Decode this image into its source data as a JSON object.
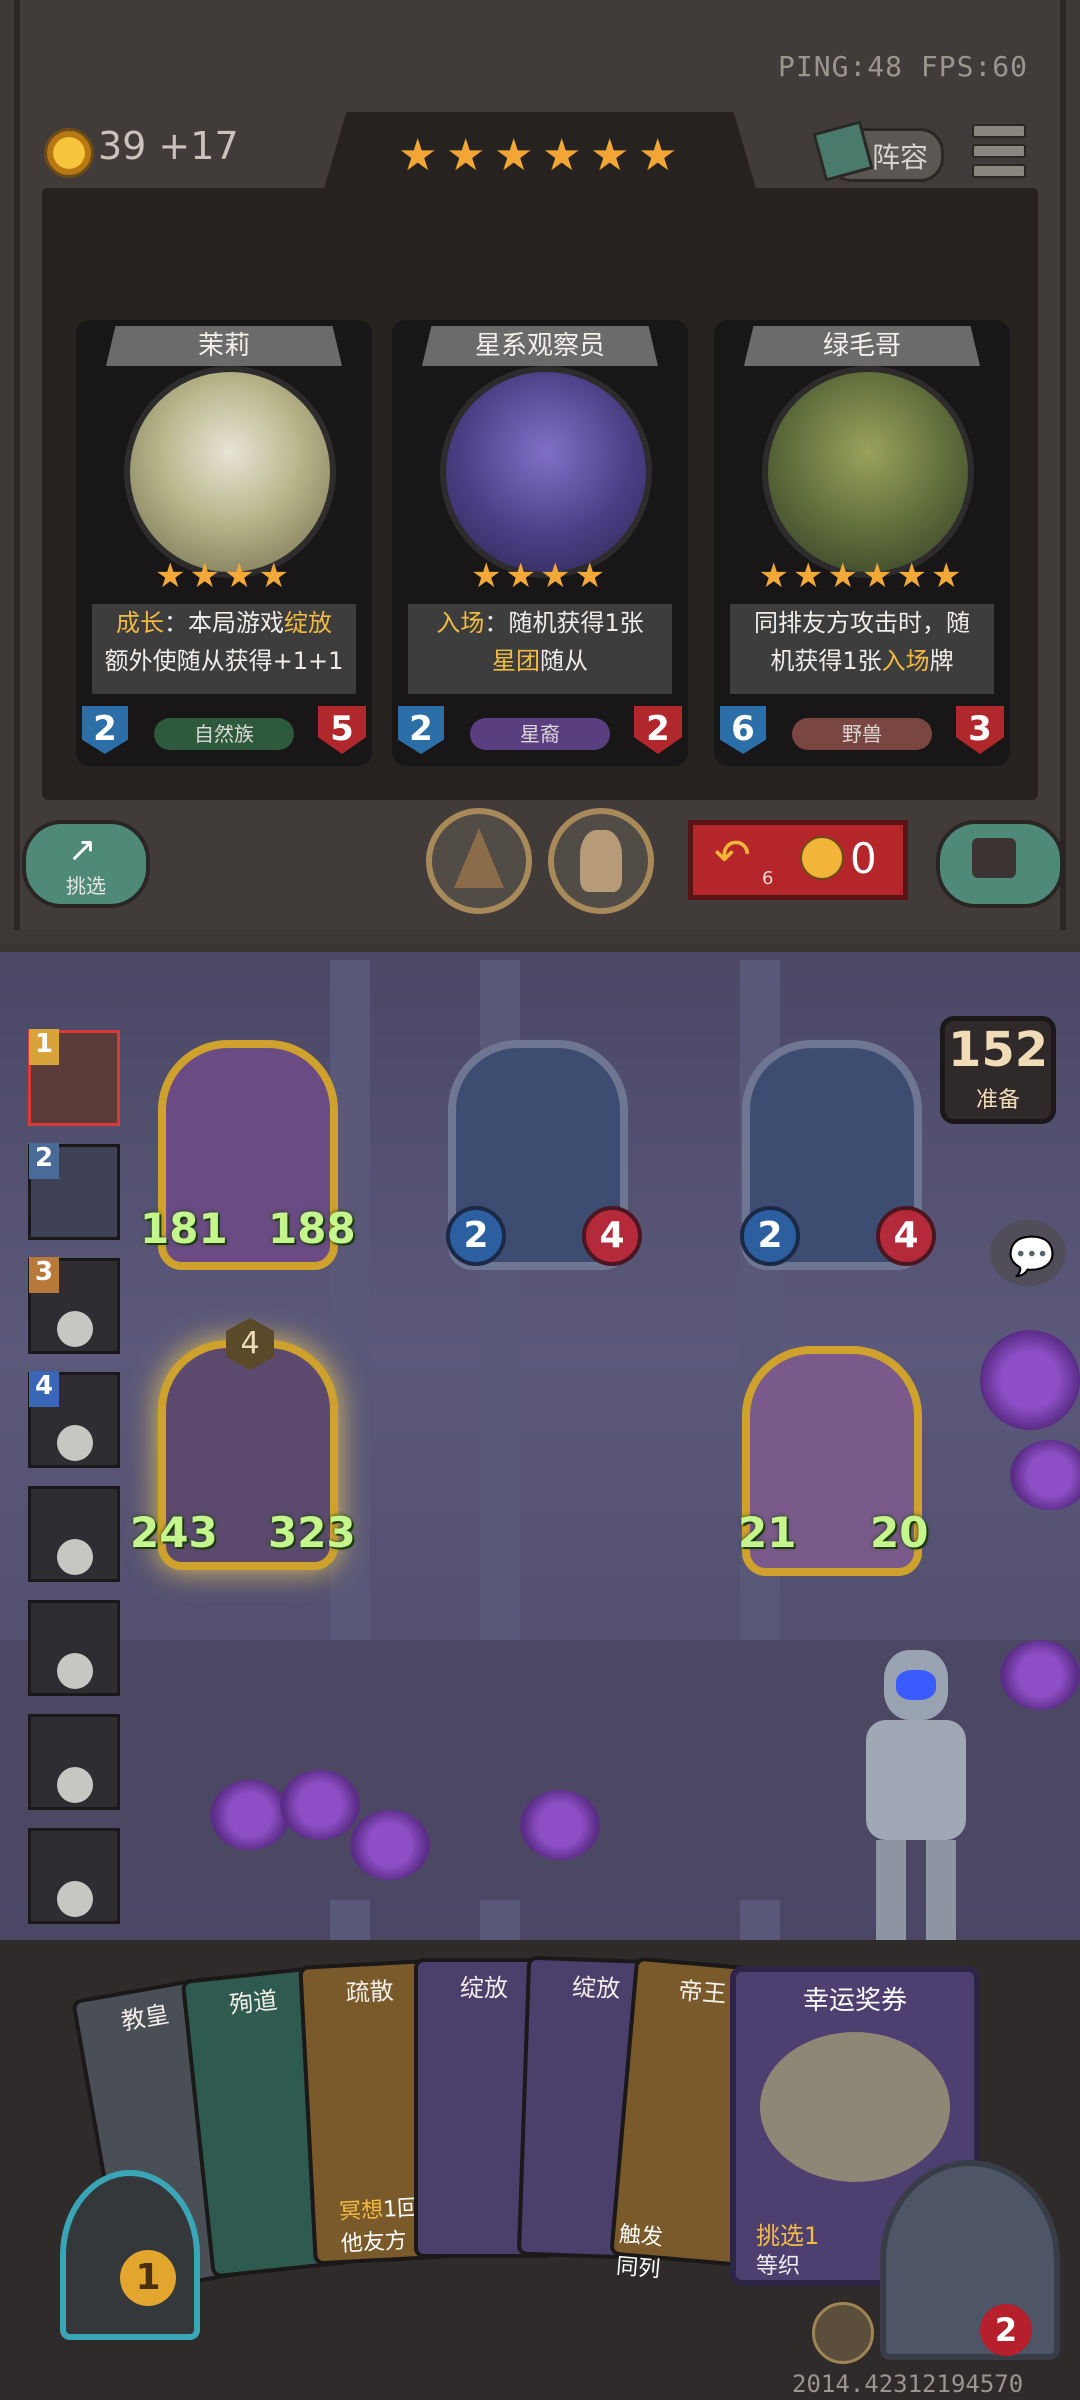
{
  "status": {
    "ping_fps": "PING:48   FPS:60"
  },
  "gold": {
    "display": "39 +17"
  },
  "tavern_stars": [
    "★",
    "★",
    "★",
    "★",
    "★",
    "★"
  ],
  "lineup_button": {
    "label": "阵容"
  },
  "cards": [
    {
      "name": "茉莉",
      "stars": "★★★★",
      "desc_pre": "成长",
      "desc_mid": "：本局游戏",
      "desc_hl": "绽放",
      "desc_line2": "额外使随从获得+1+1",
      "attack": "2",
      "health": "5",
      "tribe": "自然族",
      "tribe_color": "#2d5a3c"
    },
    {
      "name": "星系观察员",
      "stars": "★★★★",
      "desc_pre": "入场",
      "desc_mid": "：随机获得1张",
      "desc_hl": "",
      "desc_line2_hl": "星团",
      "desc_line2": "随从",
      "attack": "2",
      "health": "2",
      "tribe": "星裔",
      "tribe_color": "#5a3f80"
    },
    {
      "name": "绿毛哥",
      "stars": "★★★★★★",
      "desc_pre": "",
      "desc_mid": "同排友方攻击时，随",
      "desc_hl": "",
      "desc_line2_pre": "机获得1张",
      "desc_line2_hl": "入场",
      "desc_line2": "牌",
      "attack": "6",
      "health": "3",
      "tribe": "野兽",
      "tribe_color": "#7a4641"
    }
  ],
  "shop_controls": {
    "pick_label": "挑选",
    "refresh_cost": "6",
    "refresh_gold": "0"
  },
  "board": {
    "ready_count": "152",
    "ready_label": "准备",
    "minions": [
      {
        "name": "hooded-assassin",
        "attack": "181",
        "health": "188",
        "style": "gold"
      },
      {
        "name": "explorer-1",
        "attack": "2",
        "health": "4",
        "style": "silver"
      },
      {
        "name": "explorer-2",
        "attack": "2",
        "health": "4",
        "style": "silver"
      },
      {
        "name": "axe-warrior",
        "attack": "243",
        "health": "323",
        "style": "gold",
        "tier": "4"
      },
      {
        "name": "patched-dog",
        "attack": "21",
        "health": "20",
        "style": "gold"
      }
    ]
  },
  "ranks": [
    "1",
    "2",
    "3",
    "4",
    "",
    "",
    "",
    ""
  ],
  "hand": [
    {
      "name": "教皇"
    },
    {
      "name": "殉道"
    },
    {
      "name": "疏散"
    },
    {
      "name": "绽放"
    },
    {
      "name": "绽放"
    },
    {
      "name": "帝王"
    },
    {
      "name": "幸运奖券"
    }
  ],
  "hand_texts": {
    "meditate": "冥想",
    "meditate_rest": "1回",
    "friendly": "他友方",
    "trigger": "触发",
    "same_col": "同列",
    "pick": "挑选1",
    "wait": "等织"
  },
  "hero": {
    "level": "1"
  },
  "opponent": {
    "health": "2"
  },
  "build": "2014.42312194570"
}
